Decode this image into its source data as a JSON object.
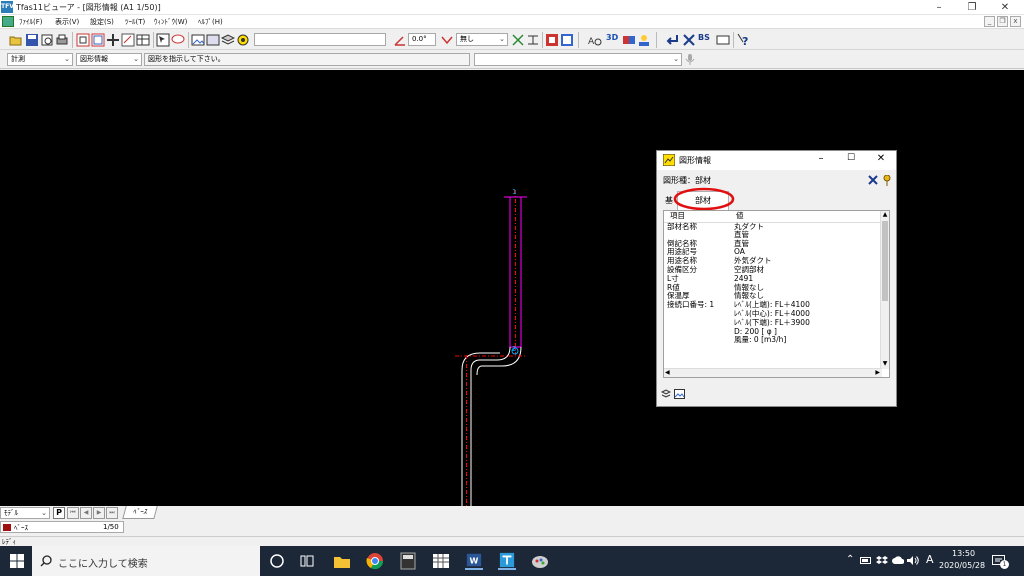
{
  "window": {
    "icon_text": "TFV",
    "title": "Tfas11ビューア - [図形情報 (A1 1/50)]",
    "minimize_glyph": "–",
    "restore_glyph": "❐",
    "close_glyph": "✕",
    "mdi_min_glyph": "_",
    "mdi_restore_glyph": "❐",
    "mdi_close_glyph": "x"
  },
  "menu": {
    "items": [
      "ﾌｧｲﾙ(F)",
      "表示(V)",
      "設定(S)",
      "ﾂｰﾙ(T)",
      "ｳｨﾝﾄﾞｳ(W)",
      "ﾍﾙﾌﾟ(H)"
    ]
  },
  "toolbar1": {
    "empty_field": "",
    "angle_value": "0.0°",
    "linetype_value": "無し",
    "bs_label": "BS",
    "view3d_label": "3D"
  },
  "toolbar2": {
    "mode_value": "計測",
    "info_value": "図形情報",
    "prompt_text": "図形を指示して下さい。",
    "command_value": ""
  },
  "canvas": {
    "marker_1": "1",
    "marker_2": "2",
    "accent_line": "#ff00ff",
    "accent_red": "#ff0000"
  },
  "dialog": {
    "title": "図形情報",
    "type_label": "図形種：部材",
    "tab_basic": "基",
    "tab_member": "部材",
    "header_item": "項目",
    "header_value": "値",
    "rows": [
      {
        "k": "部材名称",
        "v": "丸ダクト"
      },
      {
        "k": "",
        "v": "直管"
      },
      {
        "k": "倒記名称",
        "v": "直管"
      },
      {
        "k": "用途記号",
        "v": "OA"
      },
      {
        "k": "用途名称",
        "v": "外気ダクト"
      },
      {
        "k": "設備区分",
        "v": "空調部材"
      },
      {
        "k": "L寸",
        "v": "2491"
      },
      {
        "k": "R値",
        "v": "情報なし"
      },
      {
        "k": "保温厚",
        "v": "情報なし"
      },
      {
        "k": "接続口番号: 1",
        "v": "ﾚﾍﾞﾙ(上端): FL＋4100"
      },
      {
        "k": "",
        "v": "ﾚﾍﾞﾙ(中心): FL＋4000"
      },
      {
        "k": "",
        "v": "ﾚﾍﾞﾙ(下端): FL＋3900"
      },
      {
        "k": "",
        "v": "D: 200 [ φ ]"
      },
      {
        "k": "",
        "v": "風量: 0 [m3/h]"
      }
    ],
    "highlight_color": "#e01010"
  },
  "layer_panel": {
    "mode_value": "ﾓﾃﾞﾙ",
    "p_label": "P",
    "nav_first": "⏮",
    "nav_prev": "◀",
    "nav_next": "▶",
    "nav_last": "⏭",
    "tab_base": "ﾍﾞｰｽ",
    "layer_name": "ﾍﾞｰｽ",
    "scale": "1/50"
  },
  "status": {
    "text": "ﾚﾃﾞｨ"
  },
  "taskbar": {
    "search_placeholder": "ここに入力して検索",
    "tray_lang": "A",
    "time": "13:50",
    "date": "2020/05/28",
    "notify_count": "1"
  }
}
